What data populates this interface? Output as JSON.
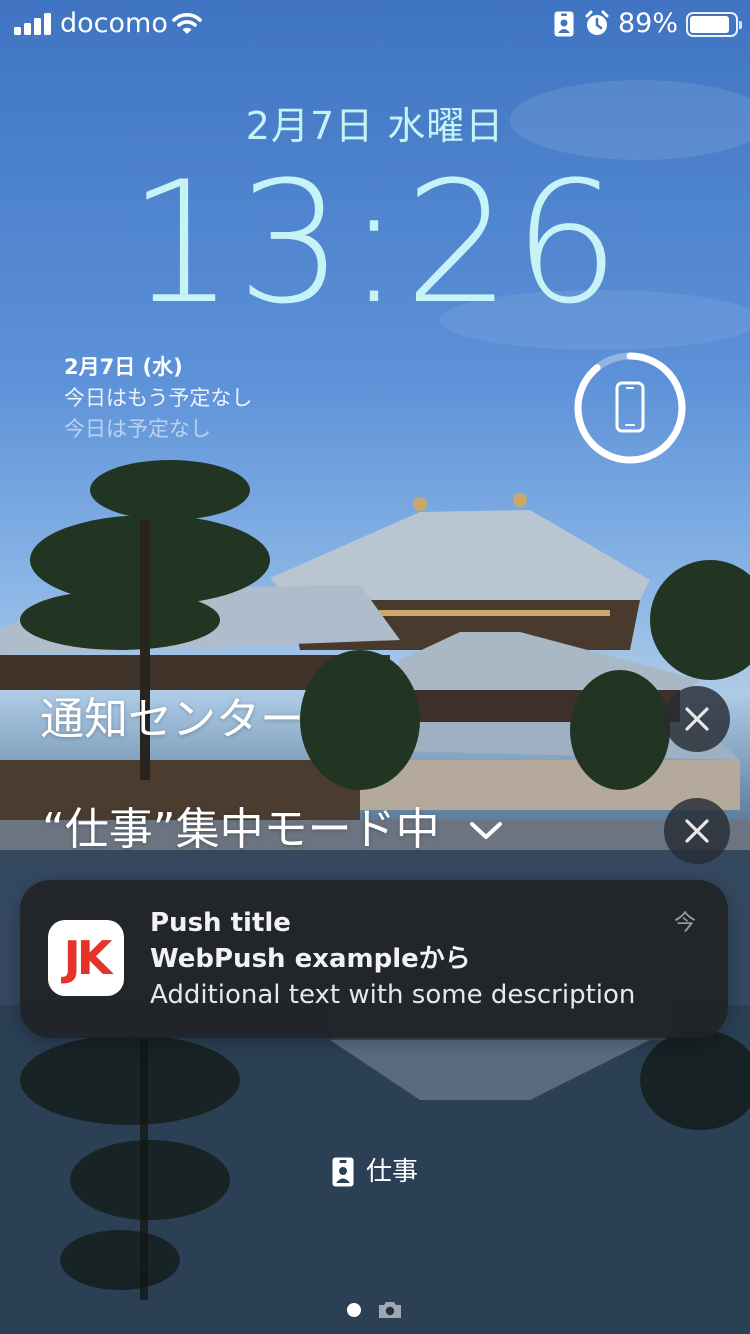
{
  "status_bar": {
    "carrier": "docomo",
    "battery_percent": "89%",
    "battery_level": 0.89,
    "icons": [
      "cellular-signal-icon",
      "wifi-icon",
      "focus-badge-icon",
      "alarm-icon",
      "battery-icon"
    ]
  },
  "lock_screen": {
    "date": "2月7日 水曜日",
    "time": "13:26"
  },
  "calendar_widget": {
    "date": "2月7日 (水)",
    "line1": "今日はもう予定なし",
    "line2": "今日は予定なし"
  },
  "battery_widget": {
    "icon": "iphone-icon",
    "level": 0.89
  },
  "notification_center": {
    "title": "通知センター",
    "focus_mode": "“仕事”集中モード中"
  },
  "notification": {
    "app_icon_text": "JK",
    "title": "Push title",
    "source": "WebPush exampleから",
    "body": "Additional text with some description",
    "time": "今"
  },
  "bottom": {
    "focus_label": "仕事"
  },
  "colors": {
    "clock": "#c6f3f6",
    "app_icon_red": "#e5332a",
    "card_bg": "#202226"
  }
}
